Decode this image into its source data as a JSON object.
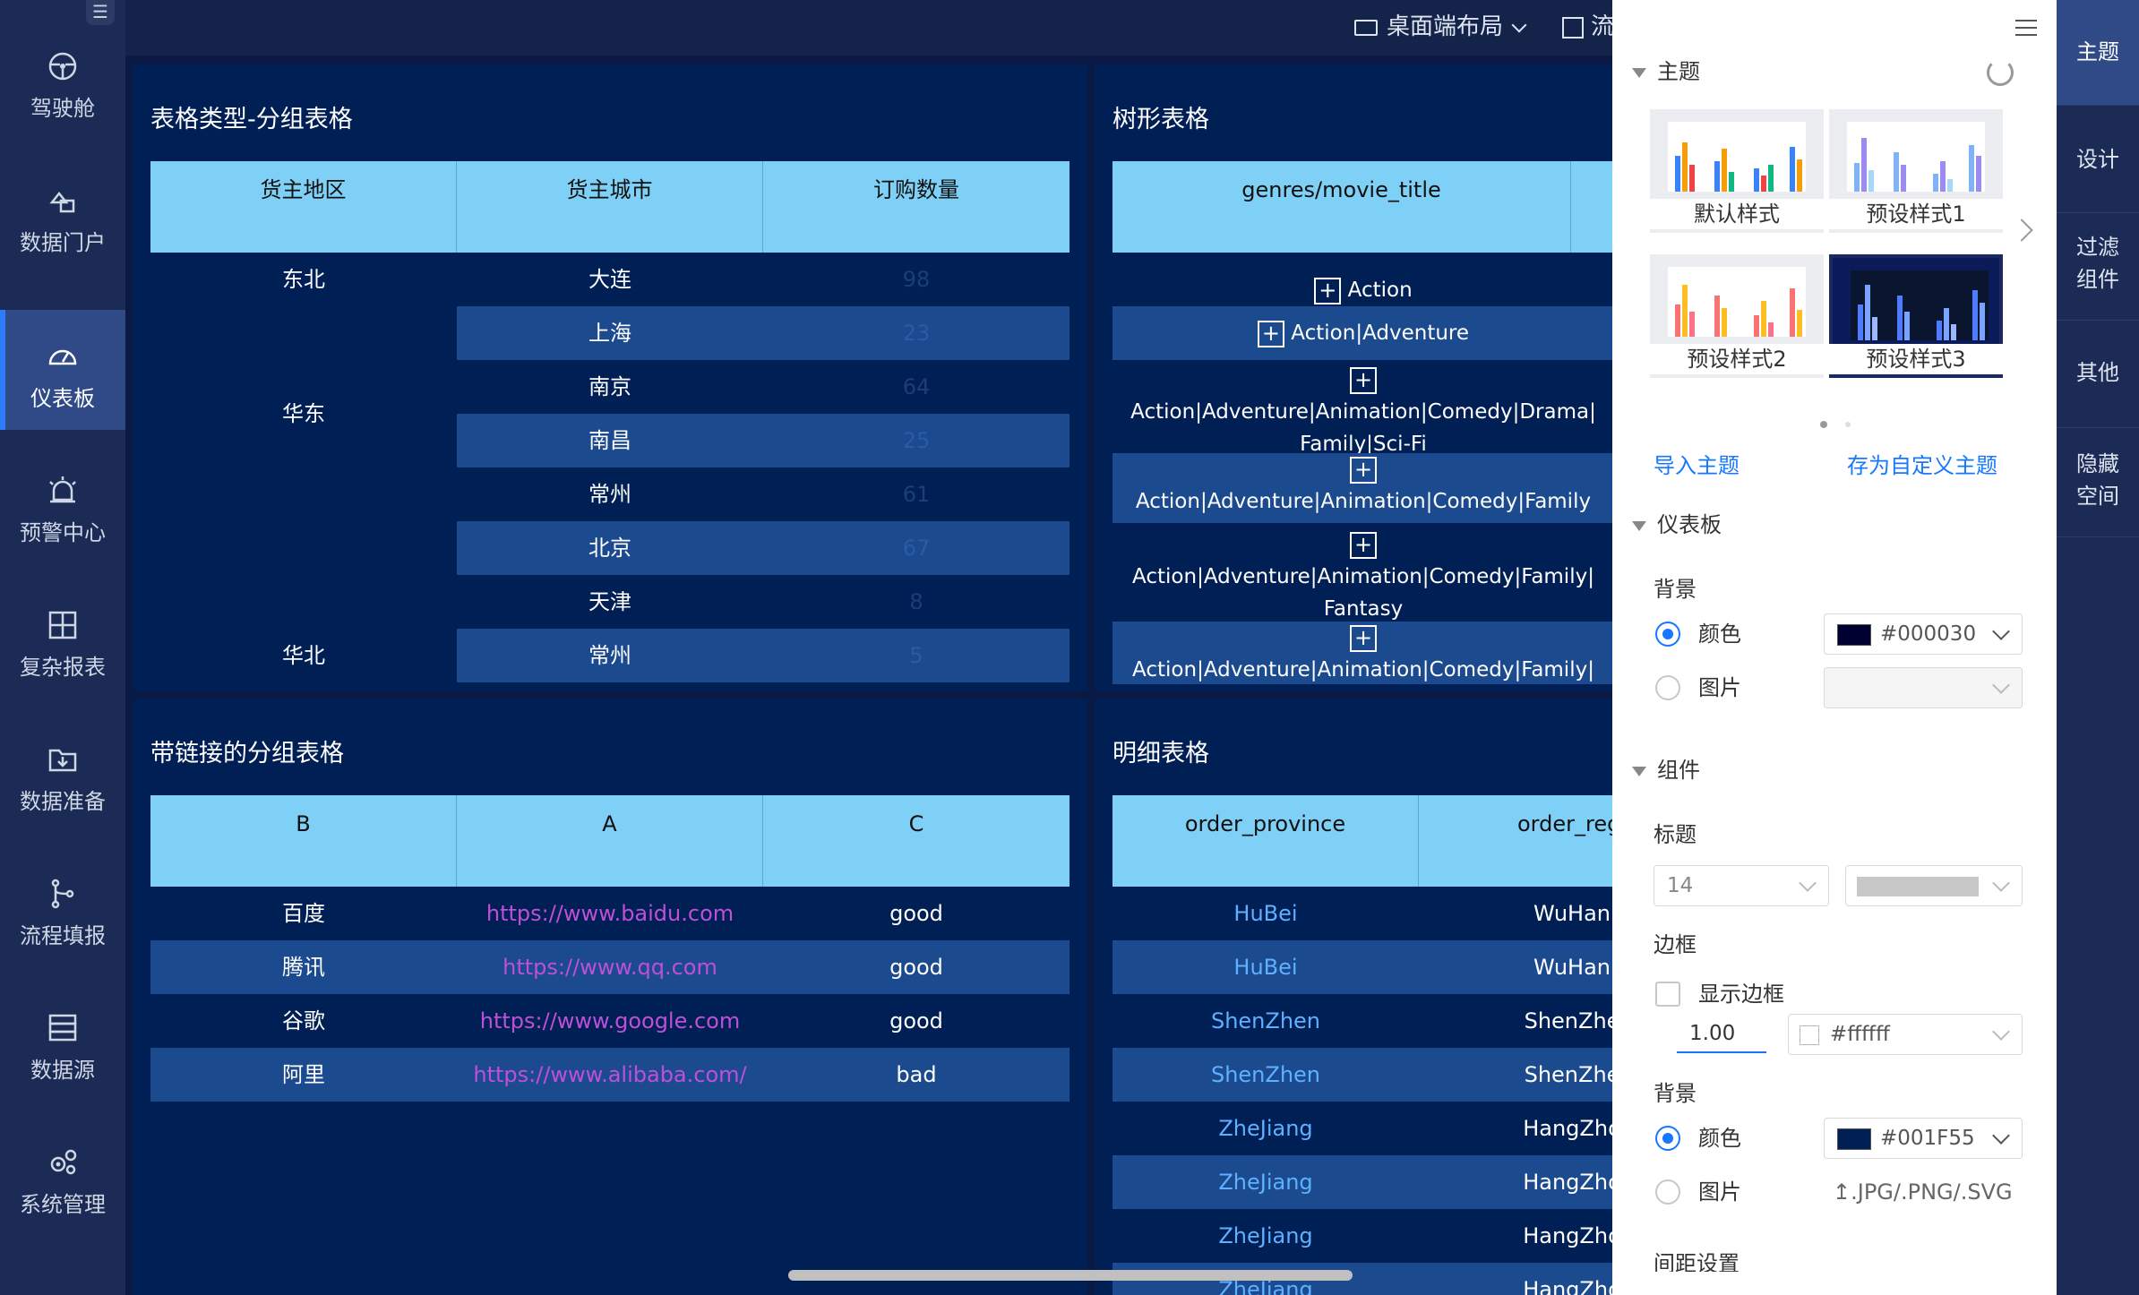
{
  "nav": {
    "items": [
      {
        "label": "驾驶舱",
        "icon": "steering-wheel-icon"
      },
      {
        "label": "数据门户",
        "icon": "portal-icon"
      },
      {
        "label": "仪表板",
        "icon": "dashboard-gauge-icon"
      },
      {
        "label": "预警中心",
        "icon": "alarm-icon"
      },
      {
        "label": "复杂报表",
        "icon": "table-grid-icon"
      },
      {
        "label": "数据准备",
        "icon": "folder-download-icon"
      },
      {
        "label": "流程填报",
        "icon": "flow-branch-icon"
      },
      {
        "label": "数据源",
        "icon": "database-icon"
      },
      {
        "label": "系统管理",
        "icon": "settings-gears-icon"
      }
    ],
    "active": "仪表板"
  },
  "topbar": {
    "layout_label": "桌面端布局",
    "cut_label": "流"
  },
  "panels": {
    "group_table": {
      "title": "表格类型-分组表格",
      "headers": [
        "货主地区",
        "货主城市",
        "订购数量"
      ],
      "regions": [
        "东北",
        "华东",
        "华北"
      ],
      "rows": [
        {
          "city": "大连",
          "qty": "98"
        },
        {
          "city": "上海",
          "qty": "23"
        },
        {
          "city": "南京",
          "qty": "64"
        },
        {
          "city": "南昌",
          "qty": "25"
        },
        {
          "city": "常州",
          "qty": "61"
        },
        {
          "city": "北京",
          "qty": "67"
        },
        {
          "city": "天津",
          "qty": "8"
        },
        {
          "city": "常州",
          "qty": "5"
        }
      ]
    },
    "tree_table": {
      "title": "树形表格",
      "header": "genres/movie_title",
      "nodes": [
        {
          "line1": "Action",
          "line2": ""
        },
        {
          "line1": "Action|Adventure",
          "line2": ""
        },
        {
          "line1": "Action|Adventure|Animation|Comedy|Drama|",
          "line2": "Family|Sci-Fi"
        },
        {
          "line1": "Action|Adventure|Animation|Comedy|Family",
          "line2": ""
        },
        {
          "line1": "Action|Adventure|Animation|Comedy|Family|",
          "line2": "Fantasy"
        },
        {
          "line1": "Action|Adventure|Animation|Comedy|Family|",
          "line2": ""
        }
      ]
    },
    "link_table": {
      "title": "带链接的分组表格",
      "headers": [
        "B",
        "A",
        "C"
      ],
      "rows": [
        {
          "b": "百度",
          "a": "https://www.baidu.com",
          "c": "good"
        },
        {
          "b": "腾讯",
          "a": "https://www.qq.com",
          "c": "good"
        },
        {
          "b": "谷歌",
          "a": "https://www.google.com",
          "c": "good"
        },
        {
          "b": "阿里",
          "a": "https://www.alibaba.com/",
          "c": "bad"
        }
      ]
    },
    "detail_table": {
      "title": "明细表格",
      "headers": [
        "order_province",
        "order_regi"
      ],
      "rows": [
        {
          "p": "HuBei",
          "r": "WuHan"
        },
        {
          "p": "HuBei",
          "r": "WuHan"
        },
        {
          "p": "ShenZhen",
          "r": "ShenZhe"
        },
        {
          "p": "ShenZhen",
          "r": "ShenZhe"
        },
        {
          "p": "ZheJiang",
          "r": "HangZho"
        },
        {
          "p": "ZheJiang",
          "r": "HangZho"
        },
        {
          "p": "ZheJiang",
          "r": "HangZho"
        },
        {
          "p": "ZheJiang",
          "r": "HangZho"
        }
      ]
    }
  },
  "theme_panel": {
    "section_theme": "主题",
    "styles": [
      "默认样式",
      "预设样式1",
      "预设样式2",
      "预设样式3"
    ],
    "import_label": "导入主题",
    "save_label": "存为自定义主题",
    "section_dashboard": "仪表板",
    "bg_label": "背景",
    "color_label": "颜色",
    "image_label": "图片",
    "dashboard_color": "#000030",
    "section_component": "组件",
    "title_label": "标题",
    "title_font_size": "14",
    "border_label": "边框",
    "show_border_label": "显示边框",
    "border_width": "1.00",
    "border_color": "#ffffff",
    "comp_bg_label": "背景",
    "comp_color_label": "颜色",
    "comp_color": "#001F55",
    "comp_image_label": "图片",
    "upload_hint": "↥.JPG/.PNG/.SVG",
    "cutoff_label": "间距设置"
  },
  "side_tabs": [
    "主题",
    "设计",
    "过滤组件",
    "其他",
    "隐藏空间"
  ],
  "colors": {
    "nav_bg": "#1b2b55",
    "canvas_bg": "#0b1a45",
    "panel_bg": "#001f55",
    "header_bg": "#7fd0f7",
    "row_alt": "#1b4a8f",
    "accent": "#1677ff"
  }
}
